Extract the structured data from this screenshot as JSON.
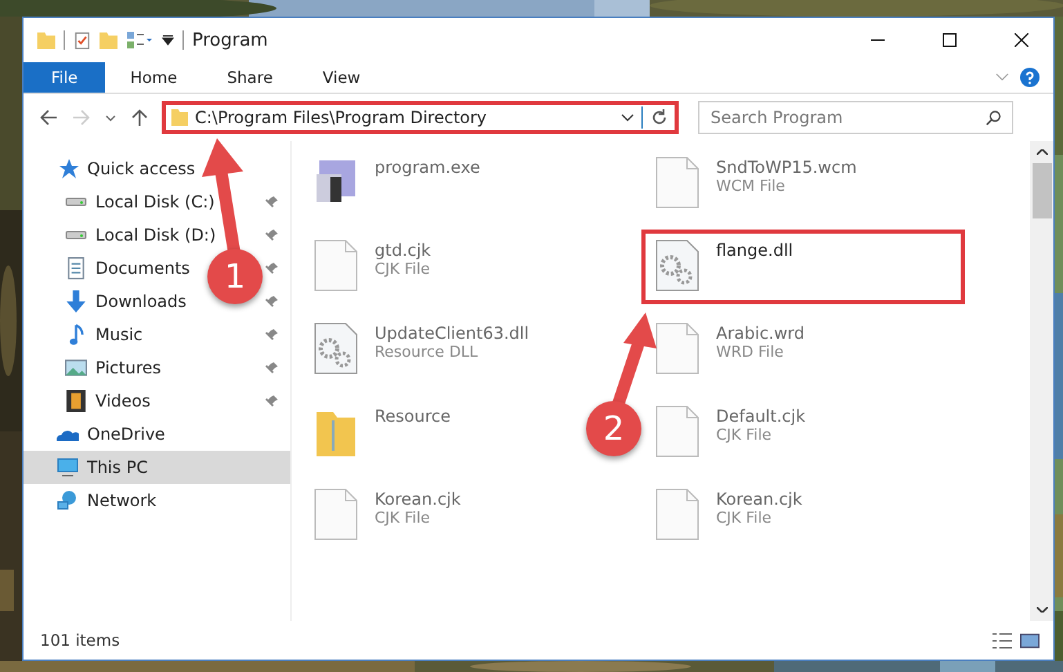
{
  "window": {
    "title": "Program"
  },
  "ribbon": {
    "tabs": [
      {
        "label": "File",
        "selected": true
      },
      {
        "label": "Home",
        "selected": false
      },
      {
        "label": "Share",
        "selected": false
      },
      {
        "label": "View",
        "selected": false
      }
    ]
  },
  "address": {
    "path": "C:\\Program Files\\Program Directory",
    "highlighted": true
  },
  "search": {
    "placeholder": "Search Program"
  },
  "sidebar": {
    "items": [
      {
        "label": "Quick access",
        "selected": false,
        "children": [
          {
            "label": "Local Disk (C:)"
          },
          {
            "label": "Local Disk (D:)"
          },
          {
            "label": "Documents"
          },
          {
            "label": "Downloads"
          },
          {
            "label": "Music"
          },
          {
            "label": "Pictures"
          },
          {
            "label": "Videos"
          }
        ]
      },
      {
        "label": "OneDrive",
        "selected": false
      },
      {
        "label": "This PC",
        "selected": true
      },
      {
        "label": "Network",
        "selected": false
      }
    ]
  },
  "files": [
    {
      "name": "program.exe",
      "kind": "exe",
      "highlighted": false
    },
    {
      "name": "SndToWP15.wcm",
      "type": "WCM File",
      "kind": "doc",
      "highlighted": false
    },
    {
      "name": "gtd.cjk",
      "type": "CJK File",
      "kind": "doc",
      "highlighted": false
    },
    {
      "name": "flange.dll",
      "kind": "dll",
      "highlighted": true
    },
    {
      "name": "UpdateClient63.dll",
      "type": "Resource DLL",
      "kind": "dll",
      "highlighted": false
    },
    {
      "name": "Arabic.wrd",
      "type": "WRD File",
      "kind": "doc",
      "highlighted": false
    },
    {
      "name": "Resource",
      "kind": "folder",
      "highlighted": false
    },
    {
      "name": "Default.cjk",
      "type": "CJK File",
      "kind": "doc",
      "highlighted": false
    },
    {
      "name": "Korean.cjk",
      "type": "CJK File",
      "kind": "doc",
      "highlighted": false
    },
    {
      "name": "Korean.cjk",
      "type": "CJK File",
      "kind": "doc",
      "highlighted": false
    }
  ],
  "status_bar": {
    "count": "101 items"
  },
  "annotations": [
    {
      "number": "1"
    },
    {
      "number": "2"
    }
  ]
}
